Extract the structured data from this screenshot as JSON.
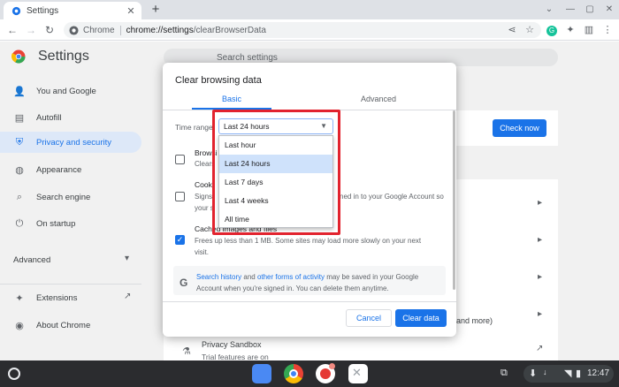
{
  "browser": {
    "tab_title": "Settings",
    "new_tab": "+",
    "omnibox_chip": "Chrome",
    "url_host": "chrome://settings",
    "url_path": "/clearBrowserData"
  },
  "settings": {
    "title": "Settings",
    "search_placeholder": "Search settings",
    "nav": [
      {
        "label": "You and Google",
        "icon": "person-icon"
      },
      {
        "label": "Autofill",
        "icon": "clipboard-icon"
      },
      {
        "label": "Privacy and security",
        "icon": "shield-icon",
        "active": true
      },
      {
        "label": "Appearance",
        "icon": "palette-icon"
      },
      {
        "label": "Search engine",
        "icon": "search-icon"
      },
      {
        "label": "On startup",
        "icon": "power-icon"
      }
    ],
    "advanced_label": "Advanced",
    "nav_bottom": [
      {
        "label": "Extensions",
        "icon": "puzzle-icon"
      },
      {
        "label": "About Chrome",
        "icon": "chrome-icon"
      }
    ],
    "check_now": "Check now",
    "background_partial": "and more)",
    "privacy_sandbox": "Privacy Sandbox",
    "privacy_sandbox_sub": "Trial features are on"
  },
  "dialog": {
    "title": "Clear browsing data",
    "tabs": {
      "basic": "Basic",
      "advanced": "Advanced"
    },
    "time_range_label": "Time range",
    "time_range_value": "Last 24 hours",
    "time_range_options": [
      "Last hour",
      "Last 24 hours",
      "Last 7 days",
      "Last 4 weeks",
      "All time"
    ],
    "items": [
      {
        "title": "Browsi",
        "desc": [
          "Clears"
        ],
        "checked": false
      },
      {
        "title": "Cooki",
        "desc_first": "Signs",
        "desc_first_tail": "ned in to your Google Account so",
        "desc_second": "your s",
        "checked": false
      },
      {
        "title": "Cached images and files",
        "desc": [
          "Frees up less than 1 MB. Some sites may load more slowly on your next",
          "visit."
        ],
        "checked": true
      }
    ],
    "info": {
      "link1": "Search history",
      "mid": " and ",
      "link2": "other forms of activity",
      "rest": " may be saved in your Google Account when you're signed in. You can delete them anytime."
    },
    "cancel": "Cancel",
    "clear": "Clear data"
  },
  "shelf": {
    "time": "12:47"
  },
  "colors": {
    "accent": "#1a73e8",
    "highlight_box": "#e2232e"
  }
}
